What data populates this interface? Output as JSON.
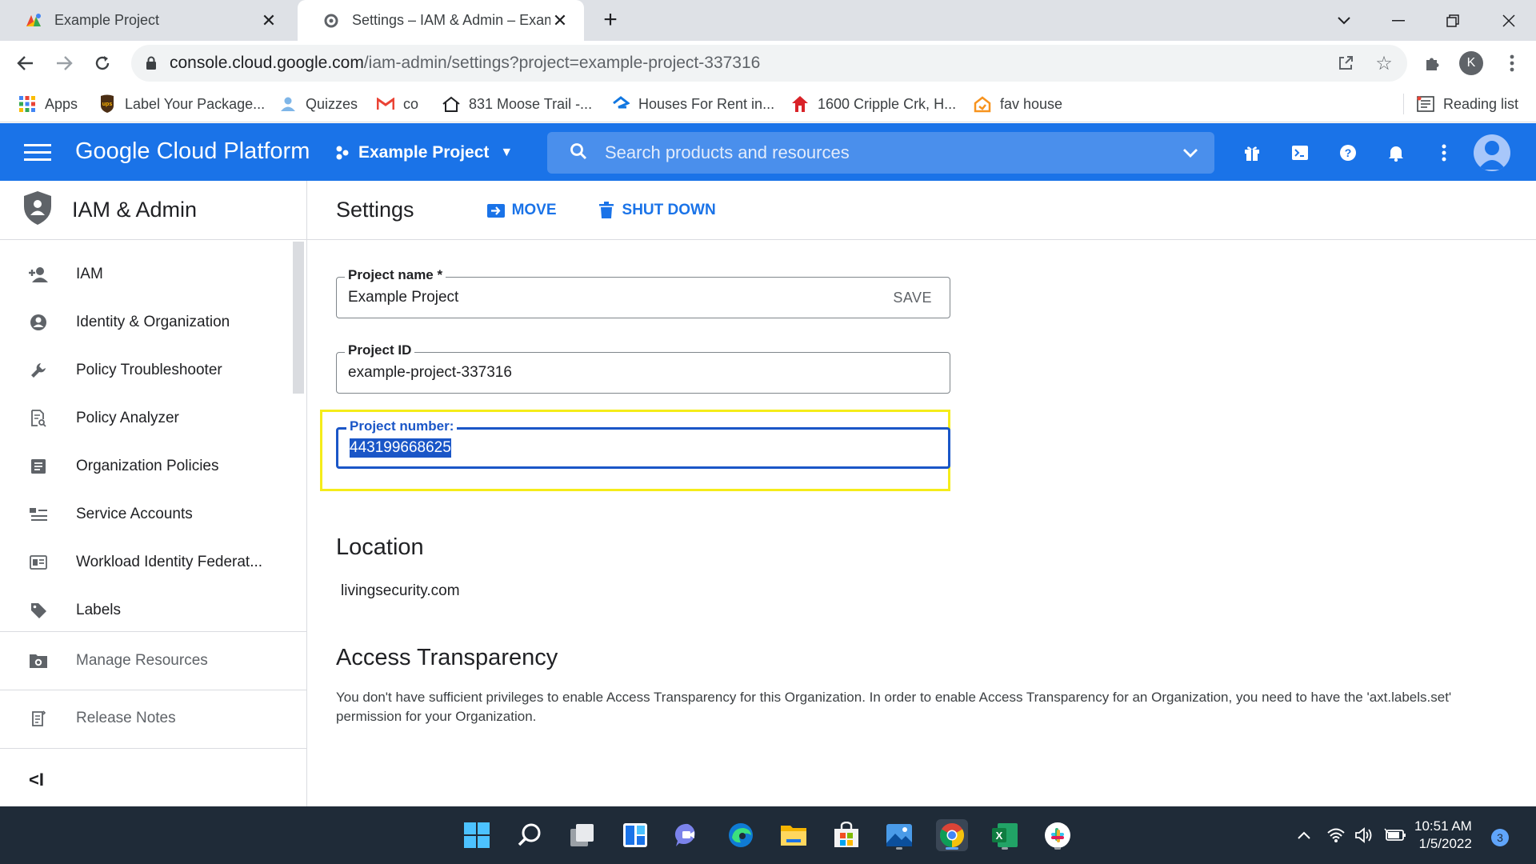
{
  "browser": {
    "tabs": [
      {
        "title": "Example Project",
        "active": false
      },
      {
        "title": "Settings – IAM & Admin – Exampl",
        "active": true
      }
    ],
    "new_tab": "+",
    "url_host": "console.cloud.google.com",
    "url_path": "/iam-admin/settings?project=example-project-337316",
    "profile_initial": "K",
    "bookmarks": [
      {
        "label": "Apps"
      },
      {
        "label": "Label Your Package..."
      },
      {
        "label": "Quizzes"
      },
      {
        "label": "co"
      },
      {
        "label": "831 Moose Trail -..."
      },
      {
        "label": "Houses For Rent in..."
      },
      {
        "label": "1600 Cripple Crk, H..."
      },
      {
        "label": "fav house"
      }
    ],
    "reading_list": "Reading list"
  },
  "header": {
    "title": "Google Cloud Platform",
    "project": "Example Project",
    "search_placeholder": "Search products and resources"
  },
  "sidebar": {
    "title": "IAM & Admin",
    "items": [
      {
        "label": "IAM",
        "icon": "person-add-icon"
      },
      {
        "label": "Identity & Organization",
        "icon": "account-circle-icon"
      },
      {
        "label": "Policy Troubleshooter",
        "icon": "wrench-icon"
      },
      {
        "label": "Policy Analyzer",
        "icon": "document-search-icon"
      },
      {
        "label": "Organization Policies",
        "icon": "list-document-icon"
      },
      {
        "label": "Service Accounts",
        "icon": "service-account-icon"
      },
      {
        "label": "Workload Identity Federat...",
        "icon": "id-card-icon"
      },
      {
        "label": "Labels",
        "icon": "tag-icon"
      }
    ],
    "manage_resources": "Manage Resources",
    "release_notes": "Release Notes",
    "collapse": "<I"
  },
  "main": {
    "title": "Settings",
    "move_label": "MOVE",
    "shutdown_label": "SHUT DOWN",
    "project_name_label": "Project name *",
    "project_name_value": "Example Project",
    "save_label": "SAVE",
    "project_id_label": "Project ID",
    "project_id_value": "example-project-337316",
    "project_number_label": "Project number:",
    "project_number_value": "443199668625",
    "location_title": "Location",
    "location_value": "livingsecurity.com",
    "access_title": "Access Transparency",
    "access_text": "You don't have sufficient privileges to enable Access Transparency for this Organization. In order to enable Access Transparency for an Organization, you need to have the 'axt.labels.set' permission for your Organization."
  },
  "taskbar": {
    "time": "10:51 AM",
    "date": "1/5/2022",
    "notifications": "3"
  },
  "colors": {
    "gcp_blue": "#1a73e8",
    "highlight_yellow": "#f5ec1a",
    "focus_blue": "#1a56c7"
  }
}
